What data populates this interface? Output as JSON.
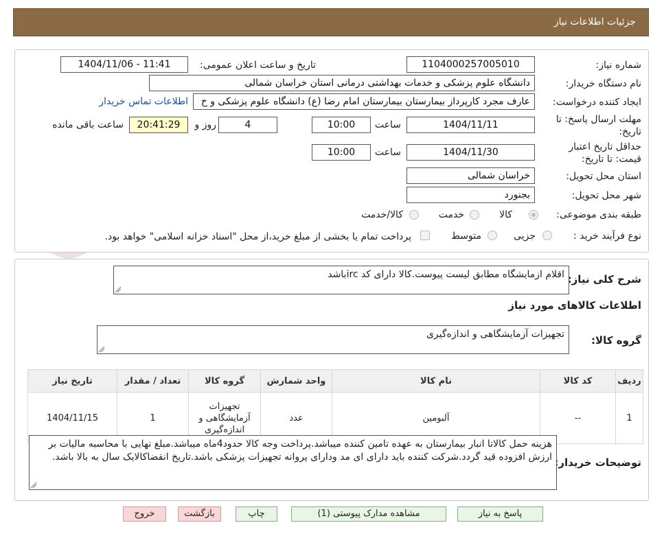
{
  "header": {
    "title": "جزئیات اطلاعات نیاز"
  },
  "watermark": {
    "text": "AriaTender.neT"
  },
  "fields": {
    "need_number_label": "شماره نیاز:",
    "need_number": "1104000257005010",
    "announce_label": "تاریخ و ساعت اعلان عمومی:",
    "announce_value": "1404/11/06 - 11:41",
    "buyer_label": "نام دستگاه خریدار:",
    "buyer_value": "دانشگاه علوم پزشکی و خدمات بهداشتی درمانی استان خراسان شمالی",
    "creator_label": "ایجاد کننده درخواست:",
    "creator_value": "عارف مجرد کارپرداز بیمارستان بیمارستان امام رضا (ع) دانشگاه علوم پزشکی و خ",
    "contact_link": "اطلاعات تماس خریدار",
    "deadline_label_1": "مهلت ارسال پاسخ: تا",
    "deadline_label_2": "تاریخ:",
    "deadline_date": "1404/11/11",
    "time_label": "ساعت",
    "deadline_time": "10:00",
    "days_value": "4",
    "days_label": "روز و",
    "remaining_time": "20:41:29",
    "remaining_label": "ساعت باقی مانده",
    "validity_label_1": "حداقل تاریخ اعتبار",
    "validity_label_2": "قیمت: تا تاریخ:",
    "validity_date": "1404/11/30",
    "validity_time_label": "ساعت",
    "validity_time": "10:00",
    "province_label": "استان محل تحویل:",
    "province_value": "خراسان شمالی",
    "city_label": "شهر محل تحویل:",
    "city_value": "بجنورد",
    "category_label": "طبقه بندی موضوعی:",
    "category_options": [
      "کالا",
      "خدمت",
      "کالا/خدمت"
    ],
    "process_label": "نوع فرآیند خرید :",
    "process_options": [
      "جزیی",
      "متوسط"
    ],
    "payment_note": "پرداخت تمام یا بخشی از مبلغ خرید،از محل \"اسناد خزانه اسلامی\" خواهد بود."
  },
  "summary": {
    "label": "شرح کلی نیاز:",
    "value": "اقلام ازمایشگاه مطابق لیست پیوست.کالا دارای کد ircباشد"
  },
  "goods": {
    "section_title": "اطلاعات کالاهای مورد نیاز",
    "group_label": "گروه کالا:",
    "group_value": "تجهیزات آزمایشگاهی و اندازه‌گیری",
    "table": {
      "headers": [
        "ردیف",
        "کد کالا",
        "نام کالا",
        "واحد شمارش",
        "گروه کالا",
        "تعداد / مقدار",
        "تاریخ نیاز"
      ],
      "rows": [
        [
          "1",
          "--",
          "آلبومین",
          "عدد",
          "تجهیزات آزمایشگاهی و اندازه‌گیری",
          "1",
          "1404/11/15"
        ]
      ]
    }
  },
  "buyer_notes": {
    "label": "توضیحات خریدار:",
    "value": "هزینه حمل کالاتا انبار بیمارستان به عهده تامین کننده میباشد.پرداخت وجه کالا حدود4ماه میباشد.مبلغ نهایی با محاسبه مالیات بر ارزش افزوده قید گردد.شرکت کننده باید دارای ای مد ودارای پروانه تجهیزات پزشکی باشد.تاریخ انقضاکالایک سال به بالا باشد."
  },
  "buttons": {
    "reply": "پاسخ به نیاز",
    "attachments": "مشاهده مدارک پیوستی (1)",
    "print": "چاپ",
    "back": "بازگشت",
    "exit": "خروج"
  }
}
